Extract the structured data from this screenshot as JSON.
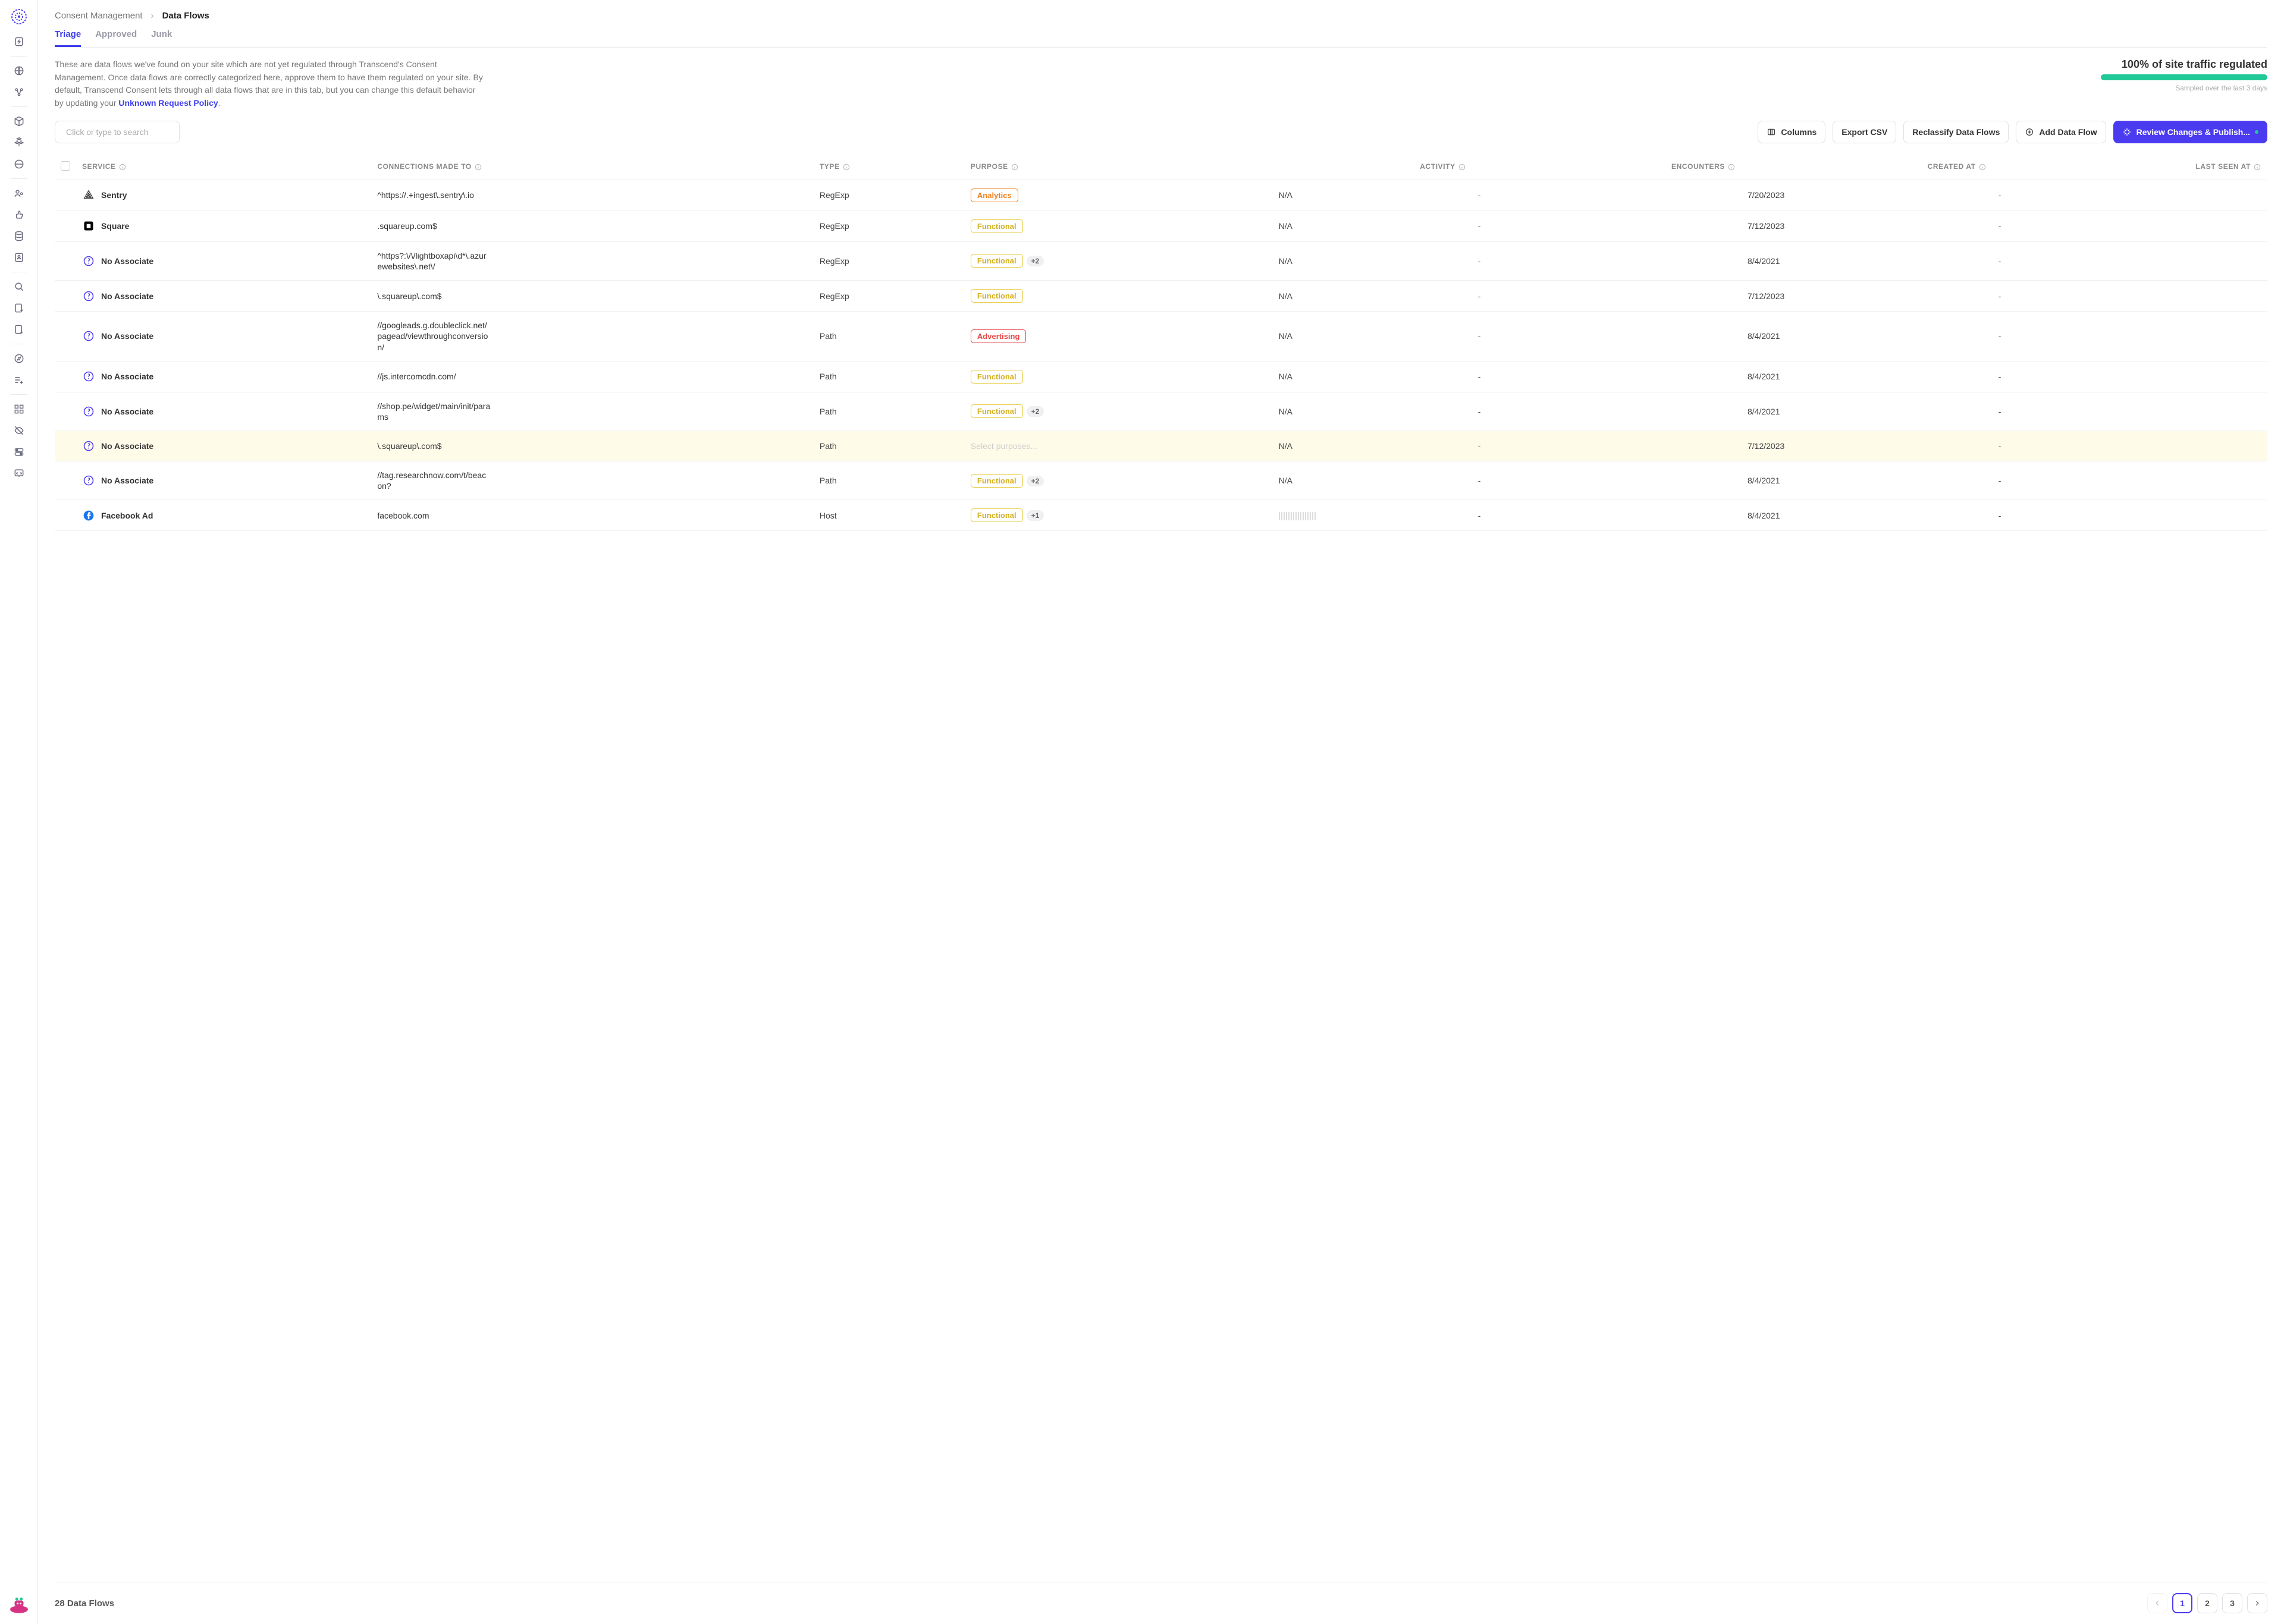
{
  "breadcrumb": {
    "parent": "Consent Management",
    "current": "Data Flows"
  },
  "tabs": {
    "triage": "Triage",
    "approved": "Approved",
    "junk": "Junk"
  },
  "description": {
    "text1": "These are data flows we've found on your site which are not yet regulated through Transcend's Consent Management. Once data flows are correctly categorized here, approve them to have them regulated on your site. By default, Transcend Consent lets through all data flows that are in this tab, but you can change this default behavior by updating your ",
    "link": "Unknown Request Policy",
    "text2": "."
  },
  "traffic": {
    "title": "100% of site traffic regulated",
    "subtitle": "Sampled over the last 3 days"
  },
  "search": {
    "placeholder": "Click or type to search"
  },
  "buttons": {
    "columns": "Columns",
    "export": "Export CSV",
    "reclassify": "Reclassify Data Flows",
    "add": "Add Data Flow",
    "publish": "Review Changes & Publish..."
  },
  "columns": {
    "service": "SERVICE",
    "connections": "CONNECTIONS MADE TO",
    "type": "TYPE",
    "purpose": "PURPOSE",
    "activity": "ACTIVITY",
    "encounters": "ENCOUNTERS",
    "created": "CREATED AT",
    "lastseen": "LAST SEEN AT"
  },
  "purposes": {
    "analytics": "Analytics",
    "functional": "Functional",
    "advertising": "Advertising",
    "select": "Select purposes..."
  },
  "rows": [
    {
      "service": "Sentry",
      "icon": "sentry",
      "conn": "^https://.+ingest\\.sentry\\.io",
      "type": "RegExp",
      "purpose": "analytics",
      "extra": 0,
      "activity": "N/A",
      "enc": "-",
      "created": "7/20/2023",
      "last": "-"
    },
    {
      "service": "Square",
      "icon": "square",
      "conn": ".squareup.com$",
      "type": "RegExp",
      "purpose": "functional",
      "extra": 0,
      "activity": "N/A",
      "enc": "-",
      "created": "7/12/2023",
      "last": "-"
    },
    {
      "service": "No Associate",
      "icon": "noassoc",
      "conn": "^https?:\\/\\/lightboxapi\\d*\\.azurewebsites\\.net\\/",
      "type": "RegExp",
      "purpose": "functional",
      "extra": 2,
      "activity": "N/A",
      "enc": "-",
      "created": "8/4/2021",
      "last": "-"
    },
    {
      "service": "No Associate",
      "icon": "noassoc",
      "conn": "\\.squareup\\.com$",
      "type": "RegExp",
      "purpose": "functional",
      "extra": 0,
      "activity": "N/A",
      "enc": "-",
      "created": "7/12/2023",
      "last": "-"
    },
    {
      "service": "No Associate",
      "icon": "noassoc",
      "conn": "//googleads.g.doubleclick.net/pagead/viewthroughconversion/",
      "type": "Path",
      "purpose": "advertising",
      "extra": 0,
      "activity": "N/A",
      "enc": "-",
      "created": "8/4/2021",
      "last": "-"
    },
    {
      "service": "No Associate",
      "icon": "noassoc",
      "conn": "//js.intercomcdn.com/",
      "type": "Path",
      "purpose": "functional",
      "extra": 0,
      "activity": "N/A",
      "enc": "-",
      "created": "8/4/2021",
      "last": "-"
    },
    {
      "service": "No Associate",
      "icon": "noassoc",
      "conn": "//shop.pe/widget/main/init/params",
      "type": "Path",
      "purpose": "functional",
      "extra": 2,
      "activity": "N/A",
      "enc": "-",
      "created": "8/4/2021",
      "last": "-"
    },
    {
      "service": "No Associate",
      "icon": "noassoc",
      "conn": "\\.squareup\\.com$",
      "type": "Path",
      "purpose": "select",
      "extra": 0,
      "activity": "N/A",
      "enc": "-",
      "created": "7/12/2023",
      "last": "-",
      "highlight": true
    },
    {
      "service": "No Associate",
      "icon": "noassoc",
      "conn": "//tag.researchnow.com/t/beacon?",
      "type": "Path",
      "purpose": "functional",
      "extra": 2,
      "activity": "N/A",
      "enc": "-",
      "created": "8/4/2021",
      "last": "-"
    },
    {
      "service": "Facebook Ad",
      "icon": "facebook",
      "conn": "facebook.com",
      "type": "Host",
      "purpose": "functional",
      "extra": 1,
      "activity": "lines",
      "enc": "-",
      "created": "8/4/2021",
      "last": "-"
    }
  ],
  "footer": {
    "count": "28 Data Flows"
  },
  "pagination": {
    "pages": [
      "1",
      "2",
      "3"
    ],
    "active": 0
  }
}
